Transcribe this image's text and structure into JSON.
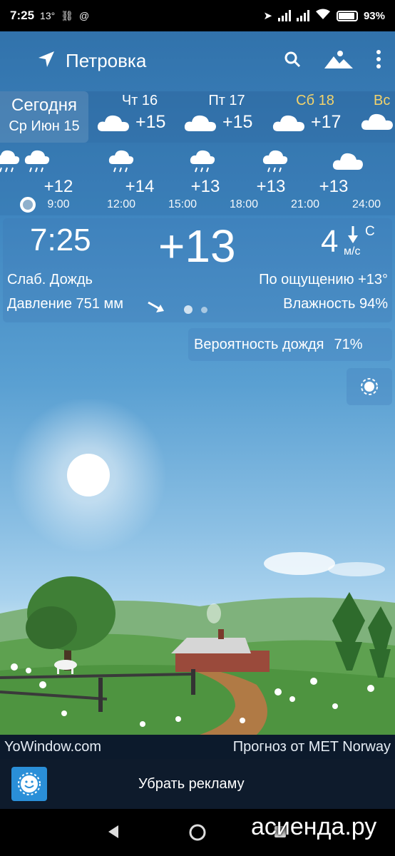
{
  "status": {
    "time": "7:25",
    "extra": "13°",
    "battery": "93%",
    "battery_level": 0.93
  },
  "header": {
    "location": "Петровка"
  },
  "days": [
    {
      "name": "Сегодня",
      "date": "Ср Июн 15"
    },
    {
      "name": "Чт 16",
      "temp": "+15"
    },
    {
      "name": "Пт 17",
      "temp": "+15"
    },
    {
      "name": "Сб 18",
      "temp": "+17",
      "color": "#f3d36b"
    },
    {
      "name": "Вс",
      "color": "#f3d36b"
    }
  ],
  "hourly": [
    {
      "temp": "+12",
      "time": "9:00"
    },
    {
      "temp": "+14",
      "time": "12:00"
    },
    {
      "temp": "+13",
      "time": "15:00"
    },
    {
      "temp": "+13",
      "time": "18:00"
    },
    {
      "temp": "+13",
      "time": "21:00"
    },
    {
      "time": "24:00"
    }
  ],
  "current": {
    "time": "7:25",
    "temp": "+13",
    "wind_speed": "4",
    "wind_dir": "С",
    "wind_unit": "м/с",
    "condition": "Слаб. Дождь",
    "feels_like": "По ощущению +13°",
    "pressure": "Давление 751 мм",
    "humidity": "Влажность 94%"
  },
  "rain_probability": {
    "label": "Вероятность дождя",
    "value": "71%"
  },
  "footer": {
    "left": "YoWindow.com",
    "right": "Прогноз от MET Norway",
    "ad_label": "Убрать рекламу"
  },
  "watermark": "асиенда.ру"
}
